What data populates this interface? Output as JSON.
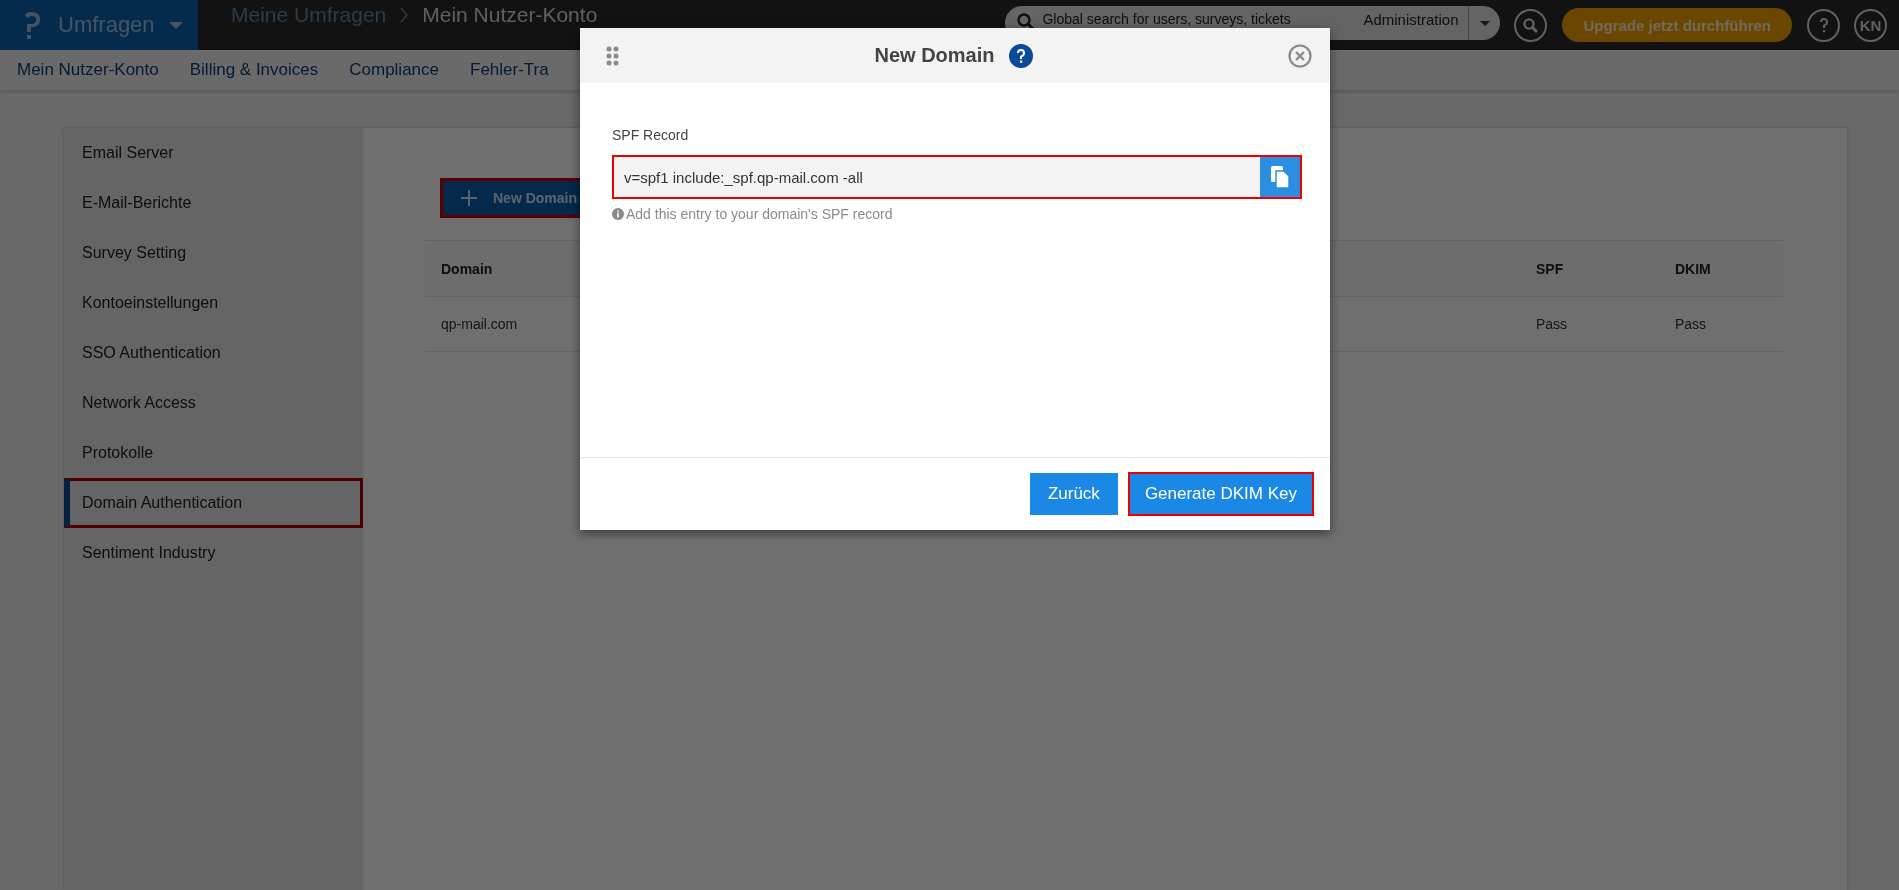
{
  "topbar": {
    "app_menu": "Umfragen",
    "breadcrumbs": [
      {
        "label": "Meine Umfragen",
        "current": false
      },
      {
        "label": "Mein Nutzer-Konto",
        "current": true
      }
    ],
    "search": {
      "placeholder": "Global search for users, surveys, tickets",
      "scope": "Administration"
    },
    "upgrade_button": "Upgrade jetzt durchführen",
    "avatar": "KN"
  },
  "subnav": {
    "items": [
      {
        "label": "Mein Nutzer-Konto"
      },
      {
        "label": "Billing & Invoices"
      },
      {
        "label": "Compliance"
      },
      {
        "label": "Fehler-Tra"
      }
    ]
  },
  "sidebar": {
    "items": [
      {
        "label": "Email Server",
        "selected": false,
        "highlighted": false
      },
      {
        "label": "E-Mail-Berichte",
        "selected": false,
        "highlighted": false
      },
      {
        "label": "Survey Setting",
        "selected": false,
        "highlighted": false
      },
      {
        "label": "Kontoeinstellungen",
        "selected": false,
        "highlighted": false
      },
      {
        "label": "SSO Authentication",
        "selected": false,
        "highlighted": false
      },
      {
        "label": "Network Access",
        "selected": false,
        "highlighted": false
      },
      {
        "label": "Protokolle",
        "selected": false,
        "highlighted": false
      },
      {
        "label": "Domain Authentication",
        "selected": true,
        "highlighted": true
      },
      {
        "label": "Sentiment Industry",
        "selected": false,
        "highlighted": false
      }
    ]
  },
  "new_domain_button": {
    "label": "New Domain",
    "highlighted": true
  },
  "table": {
    "columns": [
      "Domain",
      "SPF",
      "DKIM"
    ],
    "rows": [
      {
        "domain": "qp-mail.com",
        "spf": "Pass",
        "dkim": "Pass"
      }
    ]
  },
  "modal": {
    "title": "New Domain",
    "field_label": "SPF Record",
    "field_value": "v=spf1 include:_spf.qp-mail.com -all",
    "field_highlighted": true,
    "hint": "Add this entry to your domain's SPF record",
    "buttons": [
      {
        "label": "Zurück",
        "highlighted": false
      },
      {
        "label": "Generate DKIM Key",
        "highlighted": true
      }
    ]
  }
}
